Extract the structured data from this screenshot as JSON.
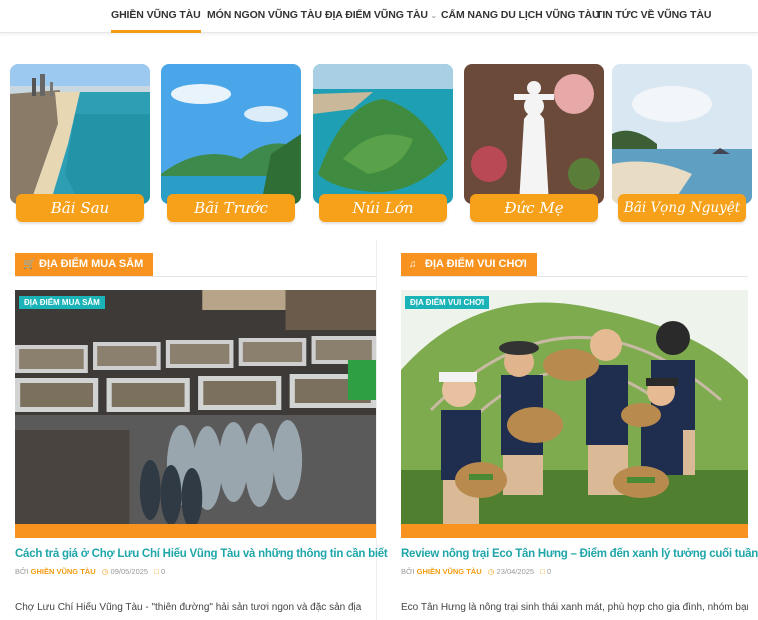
{
  "nav": {
    "items": [
      {
        "label": "GHIỀN VŨNG TÀU",
        "active": true
      },
      {
        "label": "MÓN NGON VŨNG TÀU"
      },
      {
        "label": "ĐỊA ĐIỂM VŨNG TÀU",
        "dropdown": true
      },
      {
        "label": "CẨM NANG DU LỊCH VŨNG TÀU"
      },
      {
        "label": "TIN TỨC VỀ VŨNG TÀU"
      }
    ],
    "accent": "#f39c12"
  },
  "categories": [
    {
      "label": "Bãi Sau"
    },
    {
      "label": "Bãi Trước"
    },
    {
      "label": "Núi Lớn"
    },
    {
      "label": "Đức Mẹ"
    },
    {
      "label": "Bãi Vọng Nguyệt"
    }
  ],
  "sections": [
    {
      "heading": "ĐỊA ĐIỂM MUA SẮM",
      "icon": "shopping-cart-icon",
      "post": {
        "badge": "ĐỊA ĐIỂM MUA SẮM",
        "title": "Cách trả giá ở Chợ Lưu Chí Hiếu Vũng Tàu và những thông tin cần biết",
        "by": "BỞI",
        "author": "GHIỀN VŨNG TÀU",
        "date": "09/05/2025",
        "comments": "0",
        "excerpt": "Chợ Lưu Chí Hiếu Vũng Tàu - \"thiên đường\" hải sản tươi ngon và đặc sản địa"
      }
    },
    {
      "heading": "ĐỊA ĐIỂM VUI CHƠI",
      "icon": "music-note-icon",
      "post": {
        "badge": "ĐỊA ĐIỂM VUI CHƠI",
        "title": "Review nông trại Eco Tân Hưng – Điểm đến xanh lý tưởng cuối tuần",
        "by": "BỞI",
        "author": "GHIỀN VŨNG TÀU",
        "date": "23/04/2025",
        "comments": "0",
        "excerpt": "Eco Tân Hưng là nông trại sinh thái xanh mát, phù hợp cho gia đình, nhóm bạn đến"
      }
    }
  ],
  "colors": {
    "accent": "#f7931e",
    "title": "#1fa6a8",
    "badge": "#19b3b8"
  }
}
